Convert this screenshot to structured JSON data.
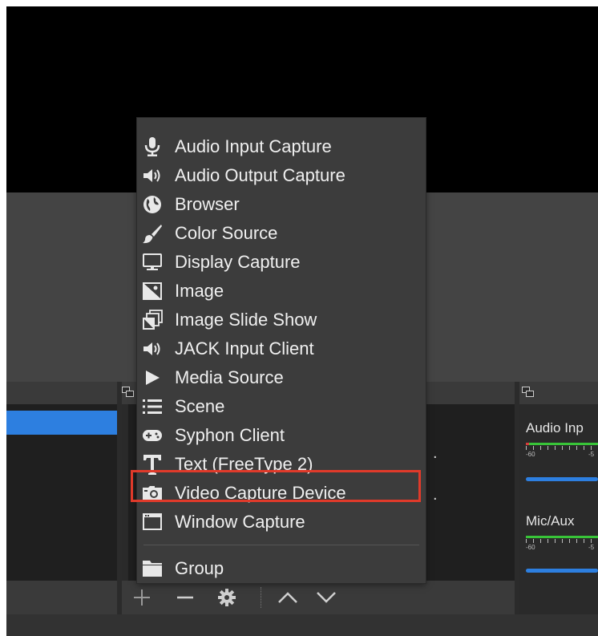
{
  "sources_hints": [
    ".",
    "."
  ],
  "mixer": {
    "channels": [
      {
        "name": "Audio Inp",
        "tick_left": "-60",
        "tick_right": "-5"
      },
      {
        "name": "Mic/Aux",
        "tick_left": "-60",
        "tick_right": "-5"
      }
    ]
  },
  "source_toolbar": {
    "add_icon": "plus",
    "remove_icon": "minus",
    "settings_icon": "gear",
    "up_icon": "chevron-up",
    "down_icon": "chevron-down"
  },
  "context_menu": {
    "items": [
      {
        "label": "Audio Input Capture",
        "icon": "microphone-icon"
      },
      {
        "label": "Audio Output Capture",
        "icon": "speaker-icon"
      },
      {
        "label": "Browser",
        "icon": "globe-icon"
      },
      {
        "label": "Color Source",
        "icon": "brush-icon"
      },
      {
        "label": "Display Capture",
        "icon": "monitor-icon"
      },
      {
        "label": "Image",
        "icon": "image-icon"
      },
      {
        "label": "Image Slide Show",
        "icon": "slideshow-icon"
      },
      {
        "label": "JACK Input Client",
        "icon": "speaker-icon"
      },
      {
        "label": "Media Source",
        "icon": "play-icon"
      },
      {
        "label": "Scene",
        "icon": "list-icon"
      },
      {
        "label": "Syphon Client",
        "icon": "gamepad-icon"
      },
      {
        "label": "Text (FreeType 2)",
        "icon": "text-icon"
      },
      {
        "label": "Video Capture Device",
        "icon": "camera-icon"
      },
      {
        "label": "Window Capture",
        "icon": "window-icon"
      },
      {
        "label": "Group",
        "icon": "folder-icon"
      }
    ],
    "highlighted_item": "Video Capture Device",
    "highlight_color": "#e03a2a"
  },
  "colors": {
    "selection": "#2d7fe0",
    "meter_green": "#38c438",
    "meter_red": "#d63b3b"
  }
}
